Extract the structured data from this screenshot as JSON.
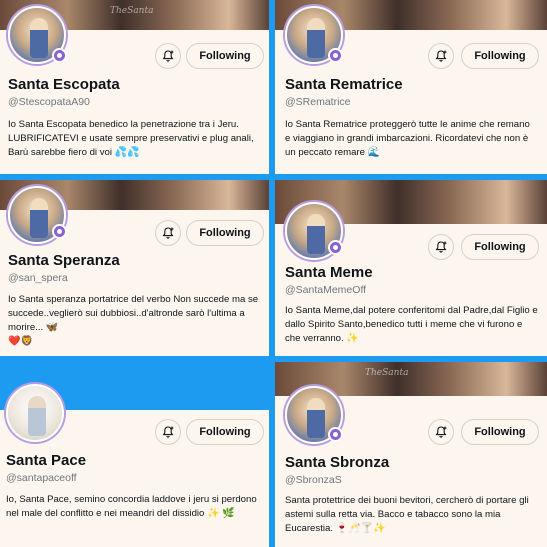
{
  "cards": [
    {
      "name": "Santa Escopata",
      "handle": "@StescopataA90",
      "button": "Following",
      "bio": "Io Santa Escopata benedico la penetrazione tra i Jeru. LUBRIFICATEVI e usate sempre preservativi e plug anali, Barù sarebbe fiero di voi",
      "bio_emoji": "💦💦",
      "watermark": "TheSanta"
    },
    {
      "name": "Santa Rematrice",
      "handle": "@SRematrice",
      "button": "Following",
      "bio": "Io Santa Rematrice proteggerò tutte le anime che remano e viaggiano in grandi imbarcazioni. Ricordatevi che non è un peccato remare",
      "bio_emoji": "🌊"
    },
    {
      "name": "Santa Speranza",
      "handle": "@san_spera",
      "button": "Following",
      "bio": "Io Santa speranza portatrice del verbo Non succede ma se succede..veglierò sui dubbiosi..d'altronde sarò l'ultima a morire...",
      "bio_emoji": "🦋",
      "bio_emoji_2": "❤️🦁"
    },
    {
      "name": "Santa Meme",
      "handle": "@SantaMemeOff",
      "button": "Following",
      "bio": "Io Santa Meme,dal potere conferitomi dal Padre,dal Figlio e dallo Spirito Santo,benedico tutti i meme che vi furono e che verranno.",
      "bio_emoji": "✨"
    },
    {
      "name": "Santa Pace",
      "handle": "@santapaceoff",
      "button": "Following",
      "bio": "Io, Santa Pace, semino concordia laddove i jeru si perdono nel male del conflitto e nei meandri del dissidio",
      "bio_emoji": "✨ 🌿"
    },
    {
      "name": "Santa Sbronza",
      "handle": "@SbronzaS",
      "button": "Following",
      "bio": "Santa protettrice dei buoni bevitori, cercherò di portare gli astemi sulla retta via.  Bacco e tabacco sono la mia Eucarestia.",
      "bio_emoji": "🍷🥂🍸✨",
      "watermark": "TheSanta"
    }
  ],
  "colors": {
    "background": "#1d9bf0",
    "card": "#fdf6ee",
    "verified": "#8a63d2"
  }
}
